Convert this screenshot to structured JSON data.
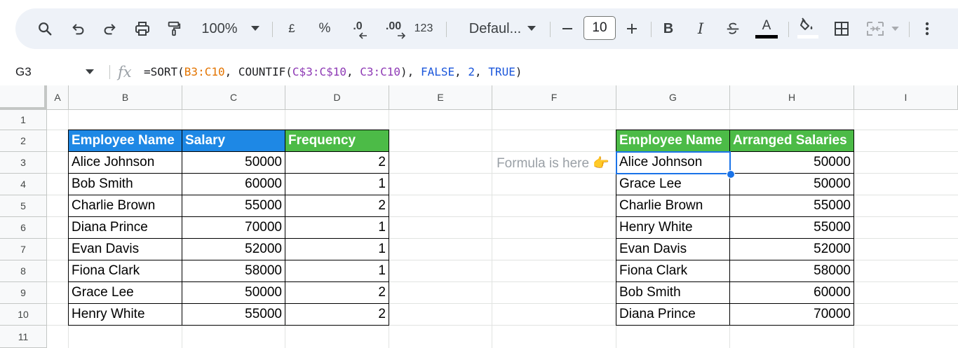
{
  "toolbar": {
    "zoom": "100%",
    "currency": "£",
    "percent": "%",
    "decrease_decimal": ".0",
    "increase_decimal": ".00",
    "number_format": "123",
    "font": "Defaul...",
    "font_size": "10",
    "bold": "B",
    "italic": "I",
    "text_color": "A"
  },
  "formula_bar": {
    "cell_ref": "G3",
    "formula_parts": [
      "=SORT(",
      "B3:C10",
      ", COUNTIF(",
      "C$3:C$10",
      ", ",
      "C3:C10",
      "), ",
      "FALSE",
      ", ",
      "2",
      ", ",
      "TRUE",
      ")"
    ]
  },
  "columns": [
    "A",
    "B",
    "C",
    "D",
    "E",
    "F",
    "G",
    "H",
    "I"
  ],
  "rows": [
    "1",
    "2",
    "3",
    "4",
    "5",
    "6",
    "7",
    "8",
    "9",
    "10",
    "11"
  ],
  "source_table": {
    "headers": [
      "Employee Name",
      "Salary",
      "Frequency"
    ],
    "rows": [
      [
        "Alice Johnson",
        "50000",
        "2"
      ],
      [
        "Bob Smith",
        "60000",
        "1"
      ],
      [
        "Charlie Brown",
        "55000",
        "2"
      ],
      [
        "Diana Prince",
        "70000",
        "1"
      ],
      [
        "Evan Davis",
        "52000",
        "1"
      ],
      [
        "Fiona Clark",
        "58000",
        "1"
      ],
      [
        "Grace Lee",
        "50000",
        "2"
      ],
      [
        "Henry White",
        "55000",
        "2"
      ]
    ]
  },
  "note": "Formula is here 👉",
  "result_table": {
    "headers": [
      "Employee Name",
      "Arranged Salaries"
    ],
    "rows": [
      [
        "Alice Johnson",
        "50000"
      ],
      [
        "Grace Lee",
        "50000"
      ],
      [
        "Charlie Brown",
        "55000"
      ],
      [
        "Henry White",
        "55000"
      ],
      [
        "Evan Davis",
        "52000"
      ],
      [
        "Fiona Clark",
        "58000"
      ],
      [
        "Bob Smith",
        "60000"
      ],
      [
        "Diana Prince",
        "70000"
      ]
    ]
  },
  "colors": {
    "header_blue": "#1e88e5",
    "header_green": "#4cbb47",
    "selection": "#1a73e8"
  }
}
